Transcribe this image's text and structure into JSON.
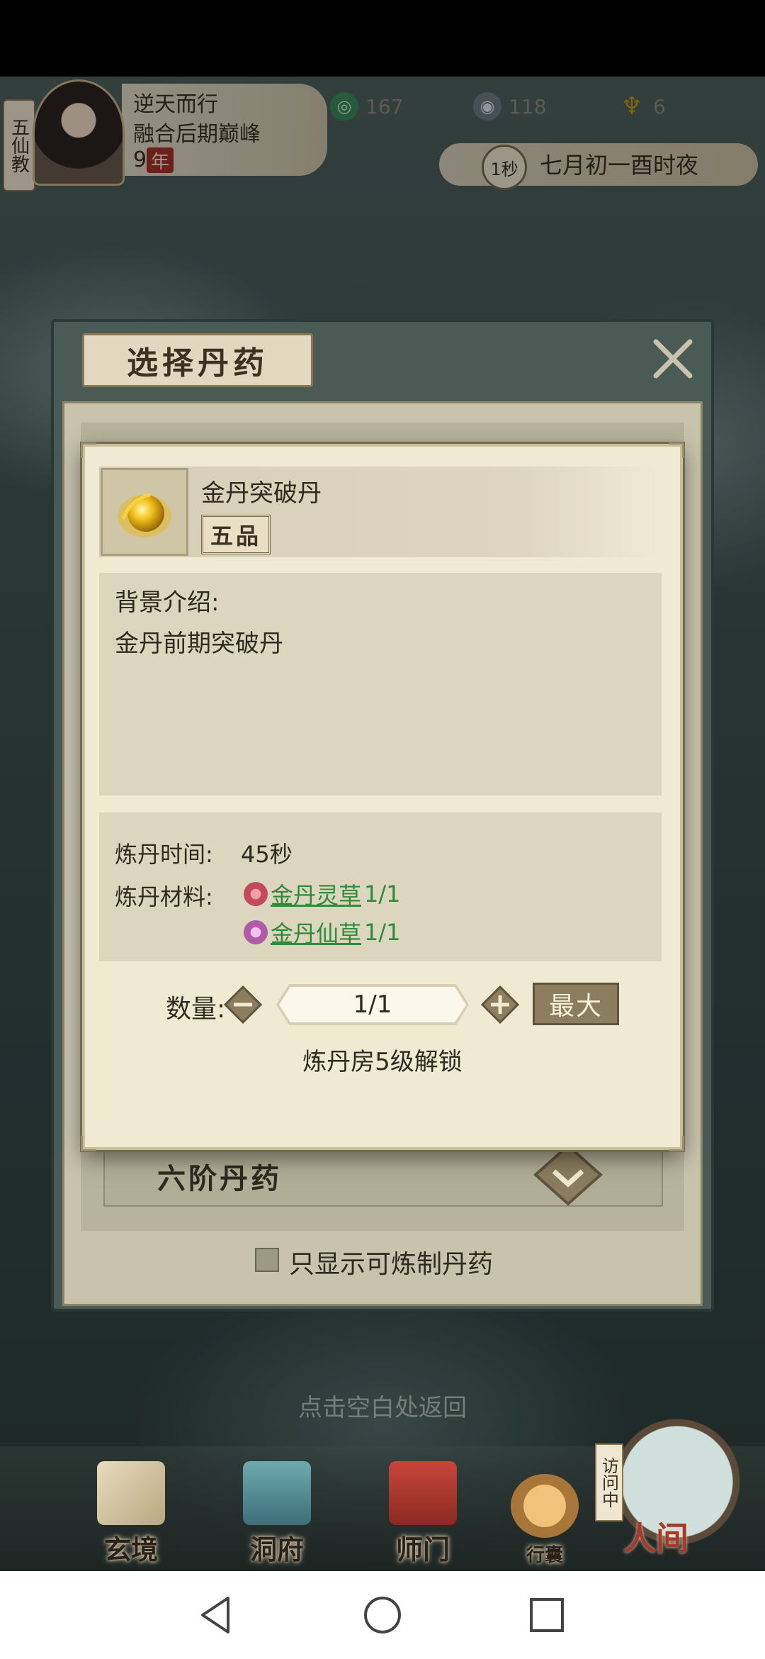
{
  "hud": {
    "sect": "五仙教",
    "player_name": "逆天而行",
    "realm": "融合后期巅峰",
    "age": "9",
    "age_unit": "年",
    "resources": [
      {
        "icon": "spirit-stone-icon",
        "value": "167"
      },
      {
        "icon": "coin-icon",
        "value": "118"
      },
      {
        "icon": "gold-trophy-icon",
        "value": "6"
      }
    ],
    "time_speed": "1秒",
    "calendar": "七月初一酉时夜"
  },
  "panel": {
    "title": "选择丹药",
    "rank_row_label": "六阶丹药",
    "filter_label": "只显示可炼制丹药"
  },
  "item": {
    "name": "金丹突破丹",
    "grade": "五品",
    "background_title": "背景介绍:",
    "background_desc": "金丹前期突破丹",
    "craft_time_label": "炼丹时间:",
    "craft_time_value": "45秒",
    "materials_label": "炼丹材料:",
    "materials": [
      {
        "name": "金丹灵草",
        "count": "1/1",
        "color": "#c24a5a"
      },
      {
        "name": "金丹仙草",
        "count": "1/1",
        "color": "#b05aa8"
      }
    ],
    "quantity_label": "数量:",
    "quantity_value": "1/1",
    "max_label": "最大",
    "unlock_text": "炼丹房5级解锁"
  },
  "hint": "点击空白处返回",
  "bottom_nav": {
    "items": [
      "玄境",
      "洞府",
      "师门",
      "行囊"
    ],
    "visiting": "访问中",
    "world": "人间"
  },
  "colors": {
    "accent_green": "#2f8a3a",
    "dialog_bg": "#f1ead3",
    "panel_dark": "#4a5a55"
  }
}
